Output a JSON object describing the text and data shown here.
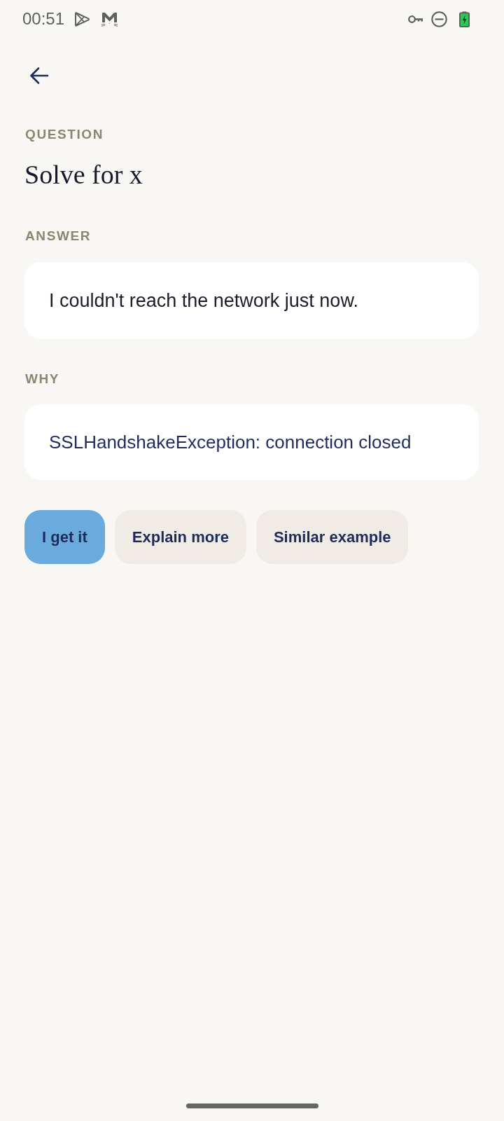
{
  "status_bar": {
    "time": "00:51"
  },
  "question": {
    "label": "QUESTION",
    "text": "Solve for x"
  },
  "answer": {
    "label": "ANSWER",
    "text": "I couldn't reach the network just now."
  },
  "why": {
    "label": "WHY",
    "text": "SSLHandshakeException: connection closed"
  },
  "actions": [
    {
      "label": "I get it",
      "selected": true
    },
    {
      "label": "Explain more",
      "selected": false
    },
    {
      "label": "Similar example",
      "selected": false
    }
  ]
}
